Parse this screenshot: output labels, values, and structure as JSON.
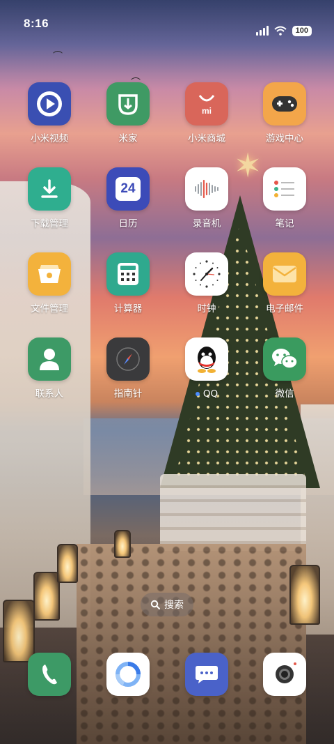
{
  "status_bar": {
    "time": "8:16",
    "battery": "100"
  },
  "apps": [
    {
      "label": "小米视频",
      "icon": "play-video-icon",
      "color": "#3a4fb2"
    },
    {
      "label": "米家",
      "icon": "mijia-icon",
      "color": "#3f9a64"
    },
    {
      "label": "小米商城",
      "icon": "shopping-bag-icon",
      "color": "#d9665a"
    },
    {
      "label": "游戏中心",
      "icon": "gamepad-icon",
      "color": "#f3a64a"
    },
    {
      "label": "下载管理",
      "icon": "download-icon",
      "color": "#2fae8f"
    },
    {
      "label": "日历",
      "icon": "calendar-icon",
      "color": "#3c4bb8",
      "calendar_day": "24"
    },
    {
      "label": "录音机",
      "icon": "waveform-icon",
      "color": "#ffffff"
    },
    {
      "label": "笔记",
      "icon": "notes-list-icon",
      "color": "#ffffff"
    },
    {
      "label": "文件管理",
      "icon": "folder-icon",
      "color": "#f3b23c"
    },
    {
      "label": "计算器",
      "icon": "calculator-icon",
      "color": "#2fa98e"
    },
    {
      "label": "时钟",
      "icon": "clock-icon",
      "color": "#ffffff"
    },
    {
      "label": "电子邮件",
      "icon": "envelope-icon",
      "color": "#f3b23c"
    },
    {
      "label": "联系人",
      "icon": "contact-person-icon",
      "color": "#3d9a66"
    },
    {
      "label": "指南针",
      "icon": "compass-icon",
      "color": "#3a3a3c"
    },
    {
      "label": "QQ",
      "icon": "qq-penguin-icon",
      "color": "#ffffff"
    },
    {
      "label": "微信",
      "icon": "wechat-icon",
      "color": "#3a9b5f"
    }
  ],
  "search": {
    "label": "搜索"
  },
  "dock": [
    {
      "icon": "phone-icon",
      "color": "#3d9a66"
    },
    {
      "icon": "browser-ring-icon",
      "color": "#ffffff"
    },
    {
      "icon": "messages-icon",
      "color": "#4a62c9"
    },
    {
      "icon": "camera-icon",
      "color": "#ffffff"
    }
  ]
}
